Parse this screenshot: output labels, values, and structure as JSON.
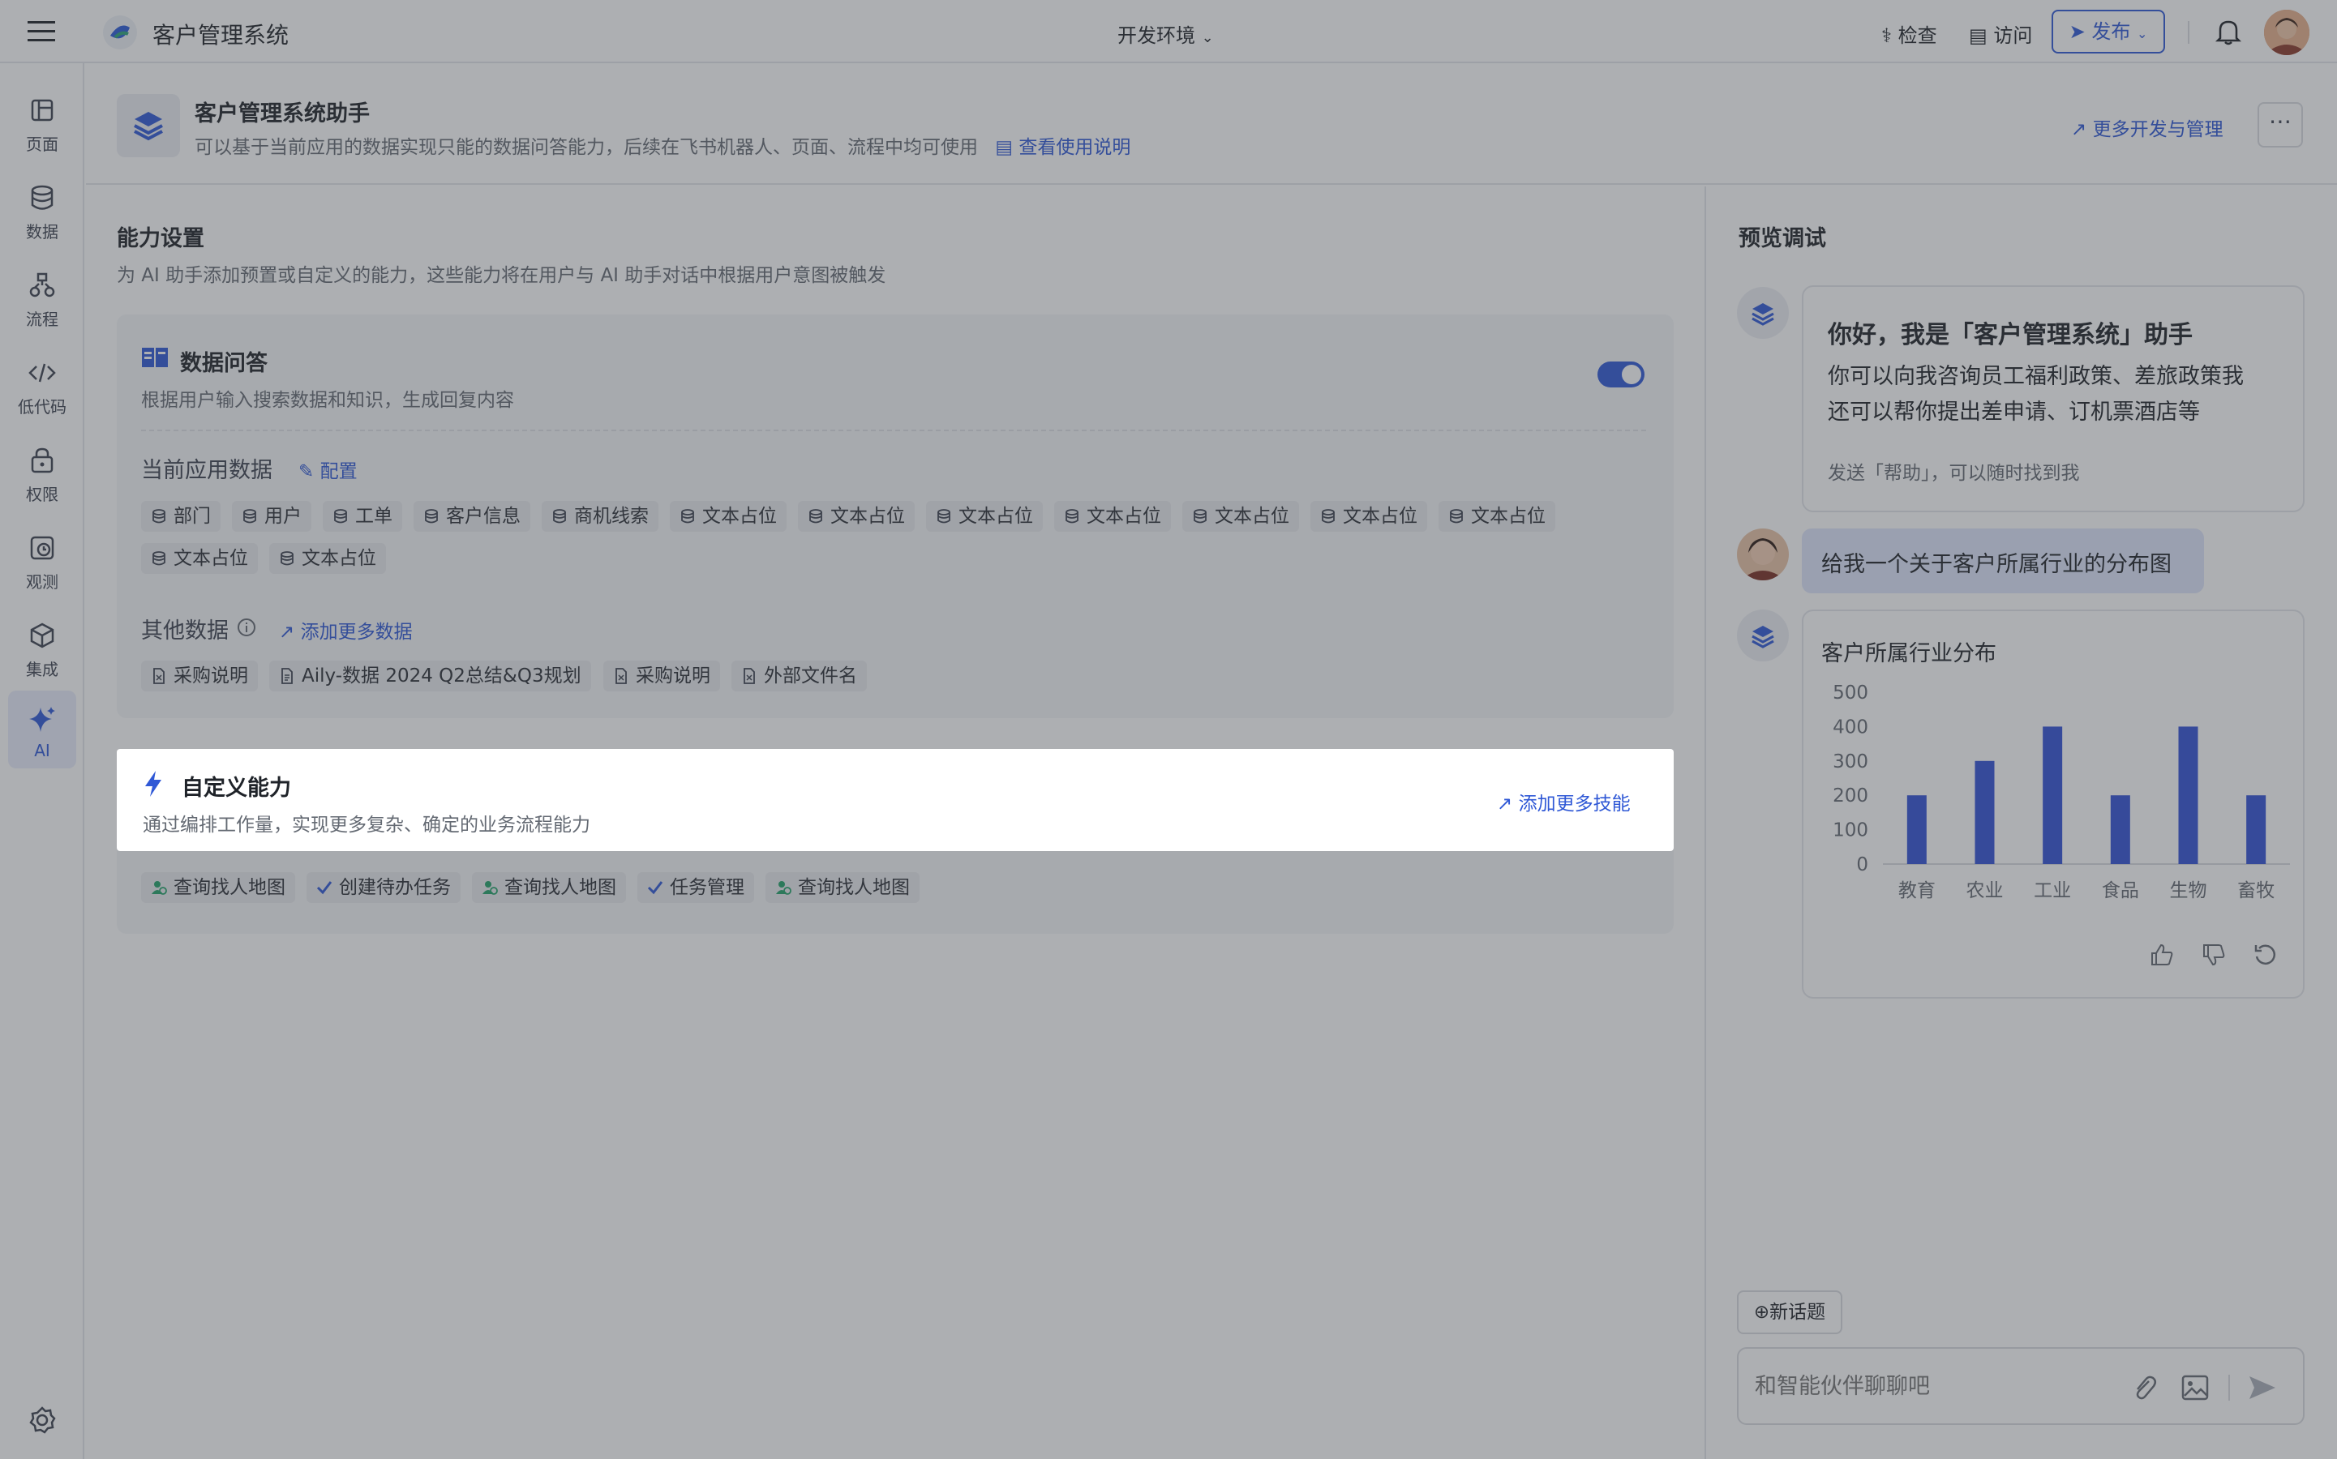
{
  "app": {
    "title": "客户管理系统",
    "env_label": "开发环境"
  },
  "topbar": {
    "check_label": "检查",
    "visit_label": "访问",
    "publish_label": "发布"
  },
  "sidebar": {
    "items": [
      {
        "label": "页面",
        "icon": "page-icon"
      },
      {
        "label": "数据",
        "icon": "database-icon"
      },
      {
        "label": "流程",
        "icon": "flow-icon"
      },
      {
        "label": "低代码",
        "icon": "code-icon"
      },
      {
        "label": "权限",
        "icon": "lock-icon"
      },
      {
        "label": "观测",
        "icon": "observe-icon"
      },
      {
        "label": "集成",
        "icon": "cube-icon"
      },
      {
        "label": "AI",
        "icon": "sparkle-icon"
      }
    ]
  },
  "assistant": {
    "name": "客户管理系统助手",
    "desc": "可以基于当前应用的数据实现只能的数据问答能力，后续在飞书机器人、页面、流程中均可使用",
    "doc_link": "查看使用说明",
    "more_link": "更多开发与管理"
  },
  "abilities": {
    "title": "能力设置",
    "desc": "为 AI 助手添加预置或自定义的能力，这些能力将在用户与 AI 助手对话中根据用户意图被触发"
  },
  "data_qa": {
    "title": "数据问答",
    "desc": "根据用户输入搜索数据和知识，生成回复内容",
    "enabled": true,
    "current_label": "当前应用数据",
    "config_link": "配置",
    "tables": [
      "部门",
      "用户",
      "工单",
      "客户信息",
      "商机线索",
      "文本占位",
      "文本占位",
      "文本占位",
      "文本占位",
      "文本占位",
      "文本占位",
      "文本占位",
      "文本占位",
      "文本占位"
    ],
    "other_label": "其他数据",
    "add_data_link": "添加更多数据",
    "files": [
      "采购说明",
      "Aily-数据 2024 Q2总结&Q3规划",
      "采购说明",
      "外部文件名"
    ]
  },
  "custom": {
    "title": "自定义能力",
    "desc": "通过编排工作量，实现更多复杂、确定的业务流程能力",
    "add_link": "添加更多技能",
    "skills": [
      "查询找人地图",
      "创建待办任务",
      "查询找人地图",
      "任务管理",
      "查询找人地图"
    ]
  },
  "preview": {
    "title": "预览调试",
    "greeting_title": "你好，我是「客户管理系统」助手",
    "greeting_line1": "你可以向我咨询员工福利政策、差旅政策我",
    "greeting_line2": "还可以帮你提出差申请、订机票酒店等",
    "greeting_hint": "发送「帮助」，可以随时找到我",
    "user_msg": "给我一个关于客户所属行业的分布图",
    "new_topic": "新话题",
    "input_placeholder": "和智能伙伴聊聊吧"
  },
  "chart_data": {
    "type": "bar",
    "title": "客户所属行业分布",
    "categories": [
      "教育",
      "农业",
      "工业",
      "食品",
      "生物",
      "畜牧"
    ],
    "values": [
      200,
      300,
      400,
      200,
      400,
      200
    ],
    "yticks": [
      "0",
      "100",
      "200",
      "300",
      "400",
      "500"
    ],
    "ylim": [
      0,
      500
    ],
    "color": "#3352d6"
  }
}
